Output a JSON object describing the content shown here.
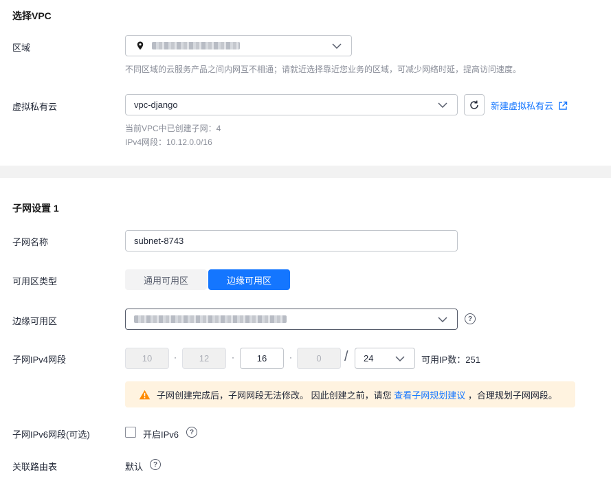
{
  "vpc_section": {
    "title": "选择VPC",
    "region": {
      "label": "区域",
      "hint": "不同区域的云服务产品之间内网互不相通；请就近选择靠近您业务的区域，可减少网络时延，提高访问速度。"
    },
    "vpc": {
      "label": "虚拟私有云",
      "selected": "vpc-django",
      "create_link": "新建虚拟私有云",
      "subnet_count": "当前VPC中已创建子网：4",
      "ipv4_range": "IPv4网段：10.12.0.0/16"
    }
  },
  "subnet_section": {
    "title": "子网设置 1",
    "name": {
      "label": "子网名称",
      "value": "subnet-8743"
    },
    "az_type": {
      "label": "可用区类型",
      "options": [
        "通用可用区",
        "边缘可用区"
      ],
      "selected": "边缘可用区"
    },
    "edge_az": {
      "label": "边缘可用区"
    },
    "ipv4": {
      "label": "子网IPv4网段",
      "octets": [
        "10",
        "12",
        "16",
        "0"
      ],
      "dot": "·",
      "slash": "/",
      "mask": "24",
      "available": "可用IP数：251"
    },
    "warning": {
      "text_before": "子网创建完成后，子网网段无法修改。 因此创建之前，请您 ",
      "link": "查看子网规划建议",
      "text_after": " ，合理规划子网网段。"
    },
    "ipv6": {
      "label": "子网IPv6网段(可选)",
      "checkbox_label": "开启IPv6"
    },
    "route_table": {
      "label": "关联路由表",
      "value": "默认"
    }
  },
  "colors": {
    "primary": "#1476ff",
    "warning_bg": "#fff3e0",
    "warning_icon": "#ff8a00"
  }
}
